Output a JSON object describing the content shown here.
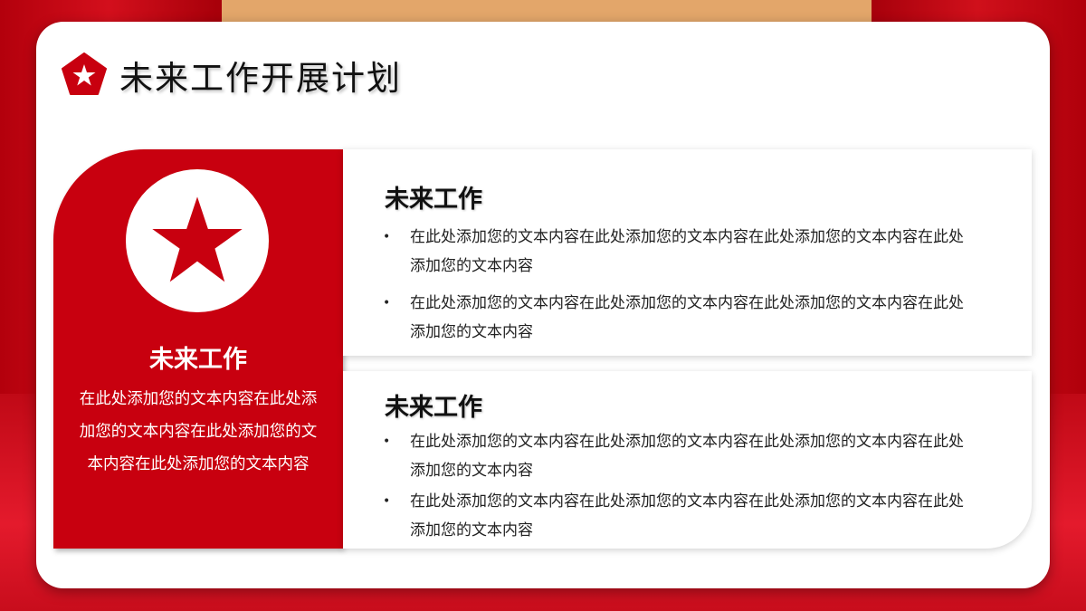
{
  "page": {
    "title": "未来工作开展计划"
  },
  "left_panel": {
    "title": "未来工作",
    "body": "在此处添加您的文本内容在此处添加您的文本内容在此处添加您的文本内容在此处添加您的文本内容"
  },
  "sections": [
    {
      "title": "未来工作",
      "bullets": [
        "在此处添加您的文本内容在此处添加您的文本内容在此处添加您的文本内容在此处添加您的文本内容",
        "在此处添加您的文本内容在此处添加您的文本内容在此处添加您的文本内容在此处添加您的文本内容"
      ]
    },
    {
      "title": "未来工作",
      "bullets": [
        "在此处添加您的文本内容在此处添加您的文本内容在此处添加您的文本内容在此处添加您的文本内容",
        "在此处添加您的文本内容在此处添加您的文本内容在此处添加您的文本内容在此处添加您的文本内容"
      ]
    }
  ],
  "icons": {
    "title_icon": "pentagon-star-icon",
    "panel_icon": "star-icon"
  },
  "colors": {
    "accent": "#c8000f",
    "background": "#b3000c",
    "card": "#ffffff",
    "stripe": "#e3a66a"
  }
}
